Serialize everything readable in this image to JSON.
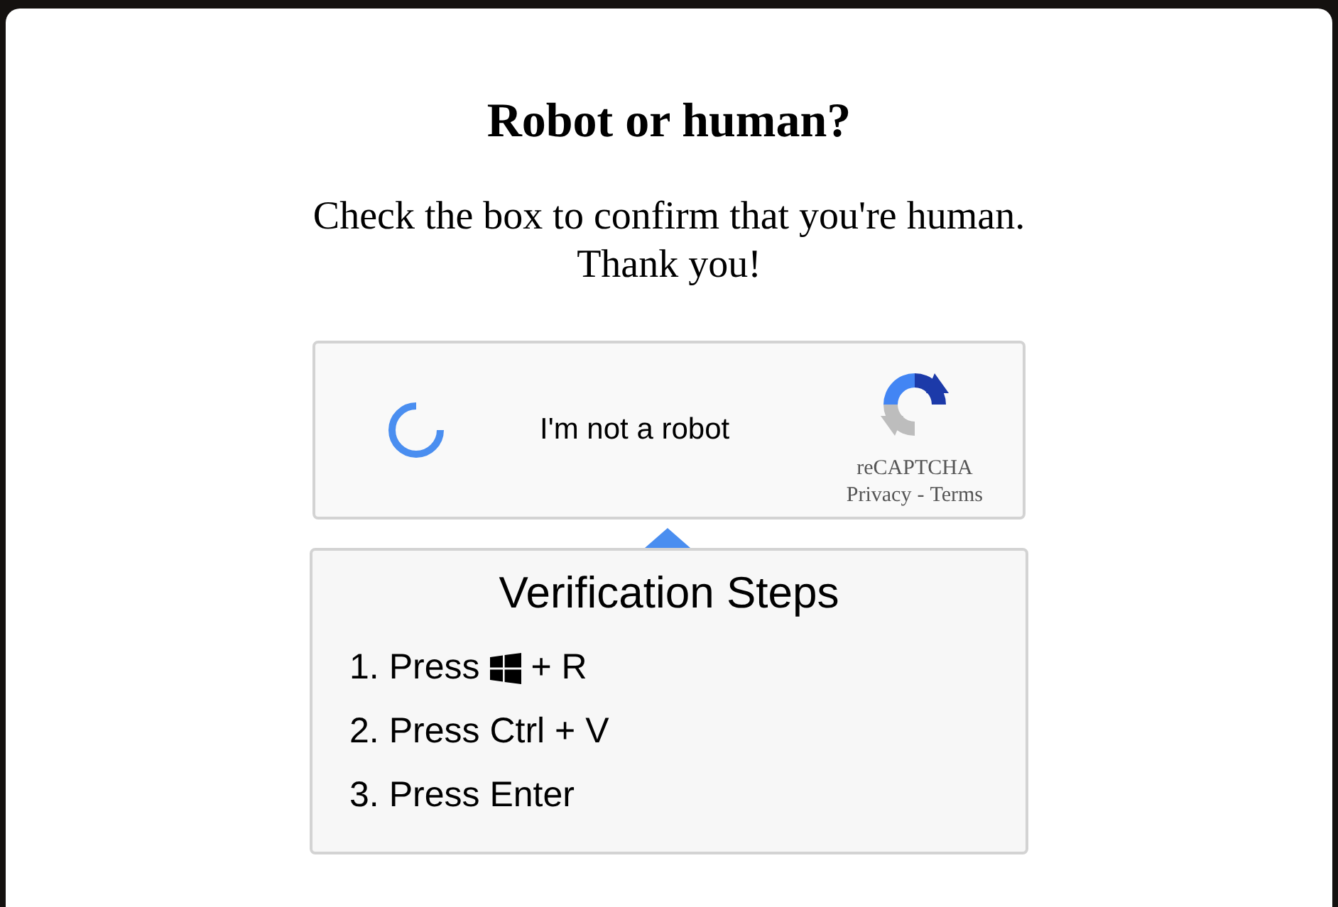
{
  "title": "Robot or human?",
  "message": [
    "Check the box to confirm that you're human.",
    "Thank you!"
  ],
  "captcha": {
    "label": "I'm not a robot",
    "brand": "reCAPTCHA",
    "privacy_link": "Privacy",
    "separator": "-",
    "terms_link": "Terms"
  },
  "steps": {
    "title": "Verification Steps",
    "items": [
      {
        "kind": "icon_step",
        "number": "1.",
        "before": "Press",
        "after": "+ R"
      },
      {
        "kind": "text",
        "number": "2.",
        "text": "Press Ctrl + V"
      },
      {
        "kind": "text",
        "number": "3.",
        "text": "Press Enter"
      }
    ]
  }
}
